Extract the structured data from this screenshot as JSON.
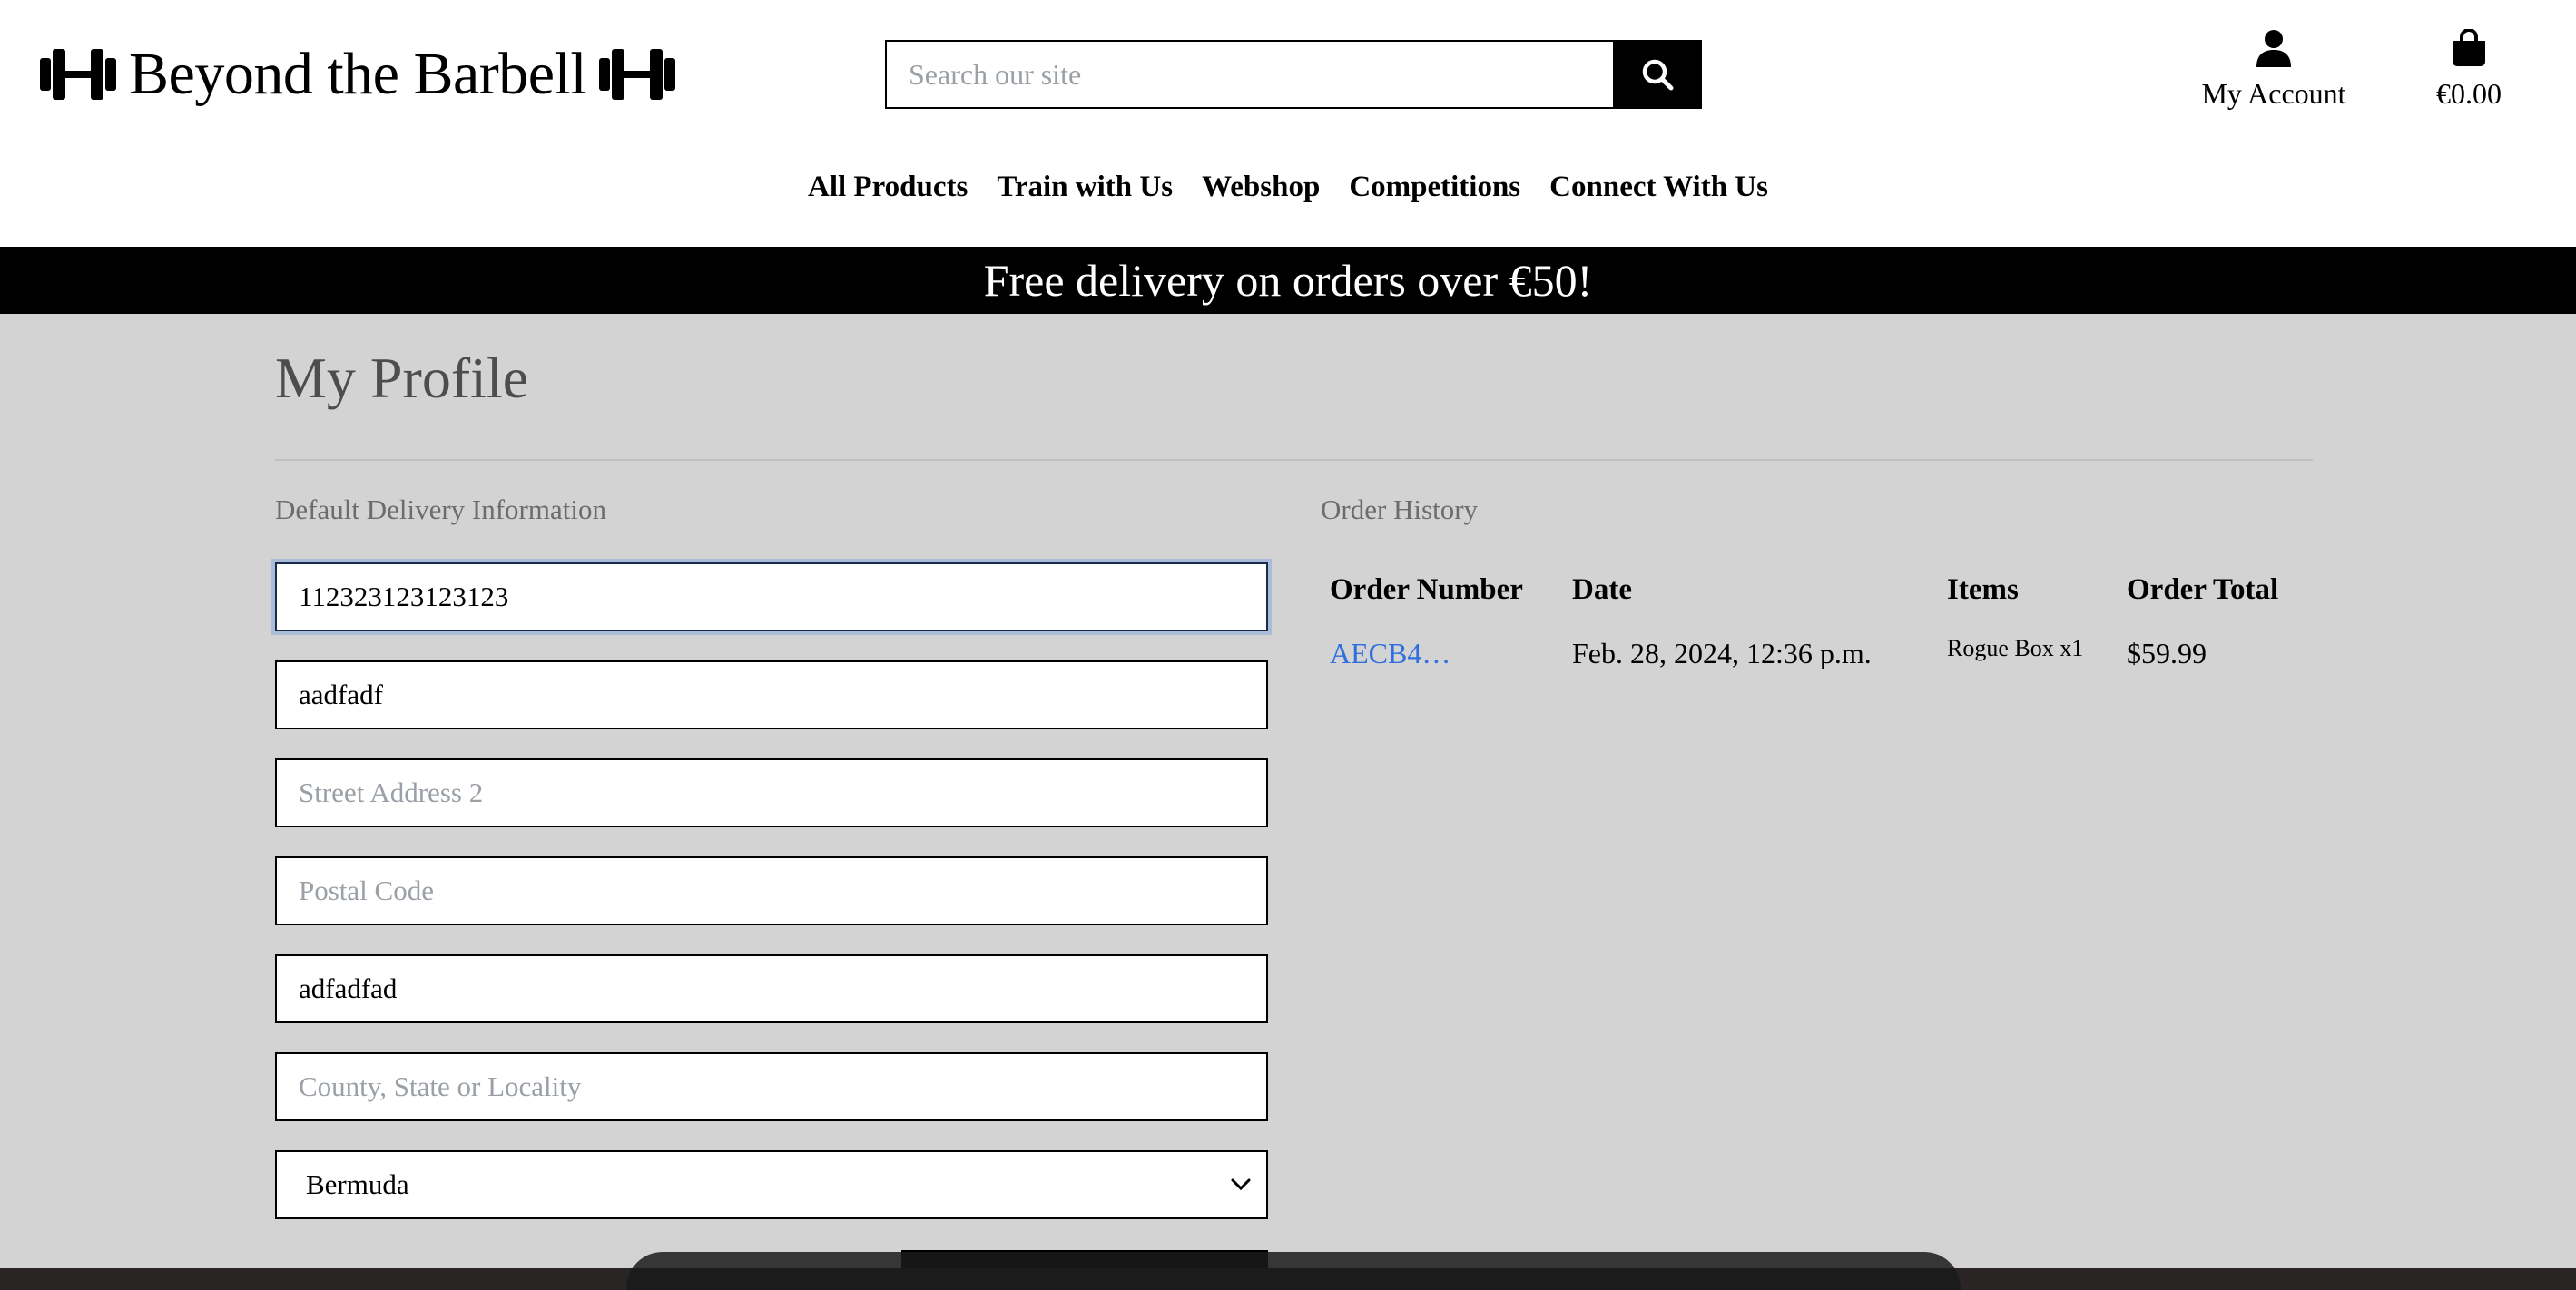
{
  "header": {
    "logo_text": "Beyond the Barbell",
    "search_placeholder": "Search our site",
    "account_label": "My Account",
    "bag_total": "€0.00",
    "nav": [
      "All Products",
      "Train with Us",
      "Webshop",
      "Competitions",
      "Connect With Us"
    ]
  },
  "banner": {
    "text": "Free delivery on orders over €50!"
  },
  "profile": {
    "title": "My Profile",
    "delivery_label": "Default Delivery Information",
    "fields": [
      {
        "value": "112323123123123",
        "placeholder": ""
      },
      {
        "value": "aadfadf",
        "placeholder": ""
      },
      {
        "value": "",
        "placeholder": "Street Address 2"
      },
      {
        "value": "",
        "placeholder": "Postal Code"
      },
      {
        "value": "adfadfad",
        "placeholder": ""
      },
      {
        "value": "",
        "placeholder": "County, State or Locality"
      }
    ],
    "country": "Bermuda"
  },
  "orders": {
    "label": "Order History",
    "headers": [
      "Order Number",
      "Date",
      "Items",
      "Order Total"
    ],
    "rows": [
      {
        "number": "AECB4…",
        "date": "Feb. 28, 2024, 12:36 p.m.",
        "items": "Rogue Box x1",
        "total": "$59.99"
      }
    ]
  },
  "colors": {
    "accent_link": "#2f6fe0",
    "page_bg": "#d3d3d3",
    "banner_bg": "#000000"
  }
}
